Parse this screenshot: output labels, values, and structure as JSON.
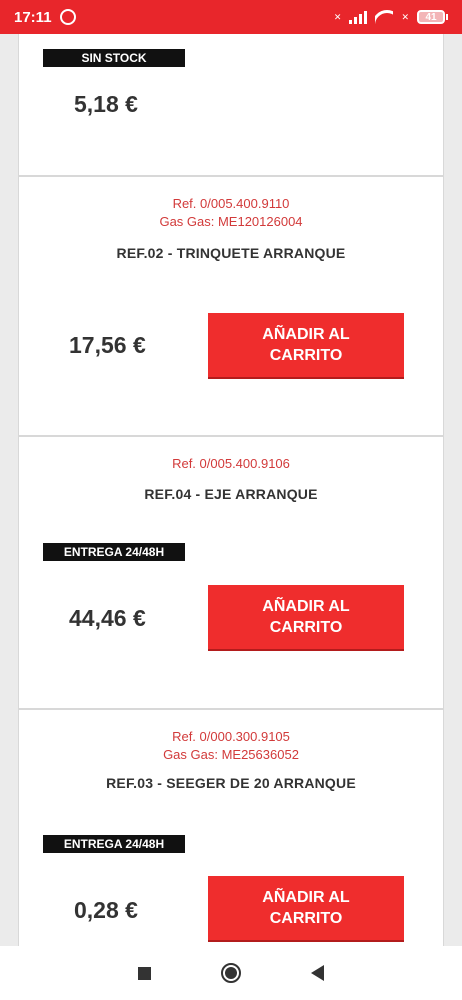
{
  "status_bar": {
    "time": "17:11",
    "battery": "41"
  },
  "products": [
    {
      "badge": "SIN STOCK",
      "price": "5,18 €"
    },
    {
      "ref": "Ref. 0/005.400.9110",
      "gasgas": "Gas Gas: ME120126004",
      "title": "REF.02 - TRINQUETE ARRANQUE",
      "price": "17,56 €",
      "button": "AÑADIR AL CARRITO"
    },
    {
      "ref": "Ref. 0/005.400.9106",
      "title": "REF.04 - EJE ARRANQUE",
      "badge": "ENTREGA 24/48H",
      "price": "44,46 €",
      "button": "AÑADIR AL CARRITO"
    },
    {
      "ref": "Ref. 0/000.300.9105",
      "gasgas": "Gas Gas: ME25636052",
      "title": "REF.03 - SEEGER DE 20 ARRANQUE",
      "badge": "ENTREGA 24/48H",
      "price": "0,28 €",
      "button": "AÑADIR AL CARRITO"
    }
  ],
  "colors": {
    "accent": "#e8262b",
    "button": "#ef2d2d",
    "ref_text": "#d23a3a"
  }
}
